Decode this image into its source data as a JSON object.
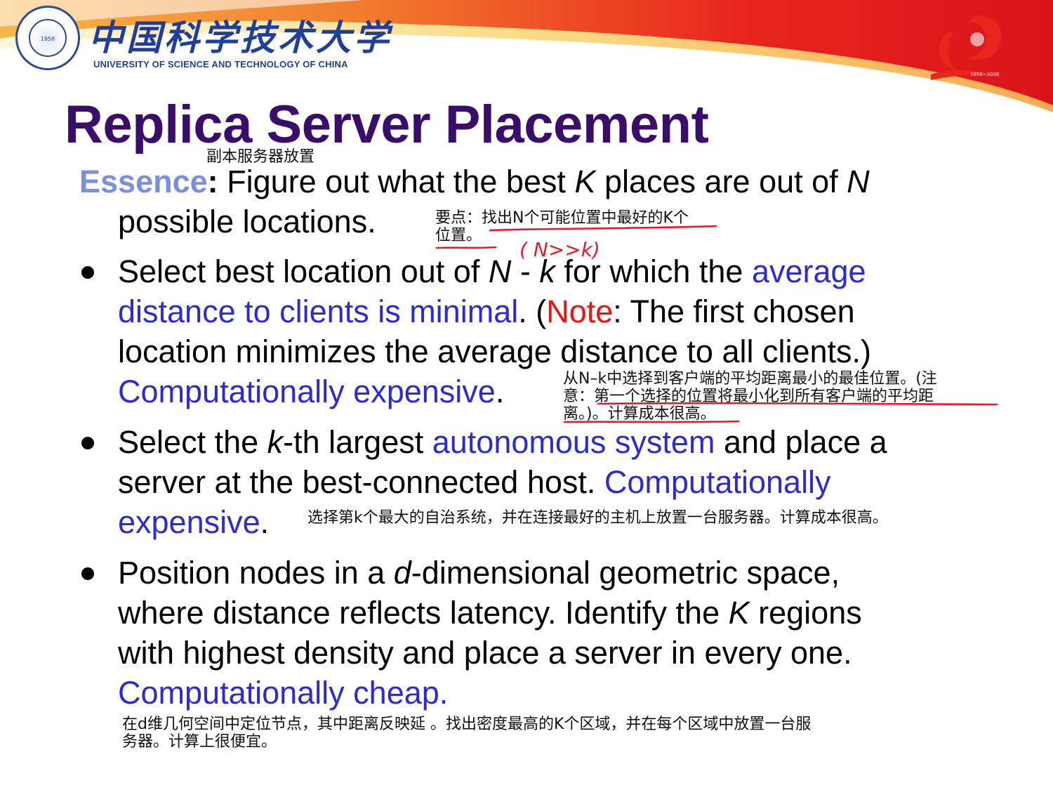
{
  "header": {
    "cn_name": "中国科学技术大学",
    "en_name": "UNIVERSITY OF SCIENCE AND TECHNOLOGY OF CHINA",
    "seal_year": "1958",
    "anniversary_years": "1958~2008",
    "colors": {
      "banner_red": "#e8261d",
      "banner_orange": "#f6a13a",
      "brand_blue": "#1f3f9a"
    }
  },
  "slide": {
    "title": "Replica Server Placement",
    "title_note": "副本服务器放置",
    "essence": {
      "label": "Essence",
      "colon": ":",
      "line1_a": " Figure out what the best ",
      "k": "K",
      "line1_b": " places are out of ",
      "n": "N",
      "line2": "possible locations.",
      "note_line1": "要点：找出N个可能位置中最好的K个",
      "note_line2": "位置。",
      "handwritten": "( N>>k)"
    },
    "bullet1": {
      "l1_a": "Select best location out of ",
      "l1_n": "N",
      "l1_dash": " - ",
      "l1_k": "k",
      "l1_b": " for which the ",
      "l1_blue": "average",
      "l2_blue": "distance to clients is minimal",
      "l2_dot": ". (",
      "l2_red": "Note",
      "l2_rest": ": The first chosen",
      "l3": "location minimizes the average distance to all clients.)",
      "l4_blue": "Computationally expensive",
      "l4_dot": ".",
      "note_line1": "从N–k中选择到客户端的平均距离最小的最佳位置。(注",
      "note_line2": "意：第一个选择的位置将最小化到所有客户端的平均距",
      "note_line3": "离。)。计算成本很高。"
    },
    "bullet2": {
      "l1_a": "Select the ",
      "l1_k": "k",
      "l1_b": "-th largest ",
      "l1_blue": "autonomous system",
      "l1_c": " and place a",
      "l2_a": "server at the best-connected host.  ",
      "l2_blue": "Computationally",
      "l3_blue": "expensive",
      "l3_dot": ".",
      "note": "选择第k个最大的自治系统，并在连接最好的主机上放置一台服务器。计算成本很高。"
    },
    "bullet3": {
      "l1_a": "Position nodes in a ",
      "l1_d": "d",
      "l1_b": "-dimensional geometric space,",
      "l2_a": "where distance reflects latency. Identify the ",
      "l2_k": "K",
      "l2_b": " regions",
      "l3": "with highest density and place a server in every one.",
      "l4_blue": "Computationally cheap.",
      "note_line1": "在d维几何空间中定位节点，其中距离反映延    。找出密度最高的K个区域，并在每个区域中放置一台服",
      "note_line2": "务器。计算上很便宜。"
    }
  }
}
